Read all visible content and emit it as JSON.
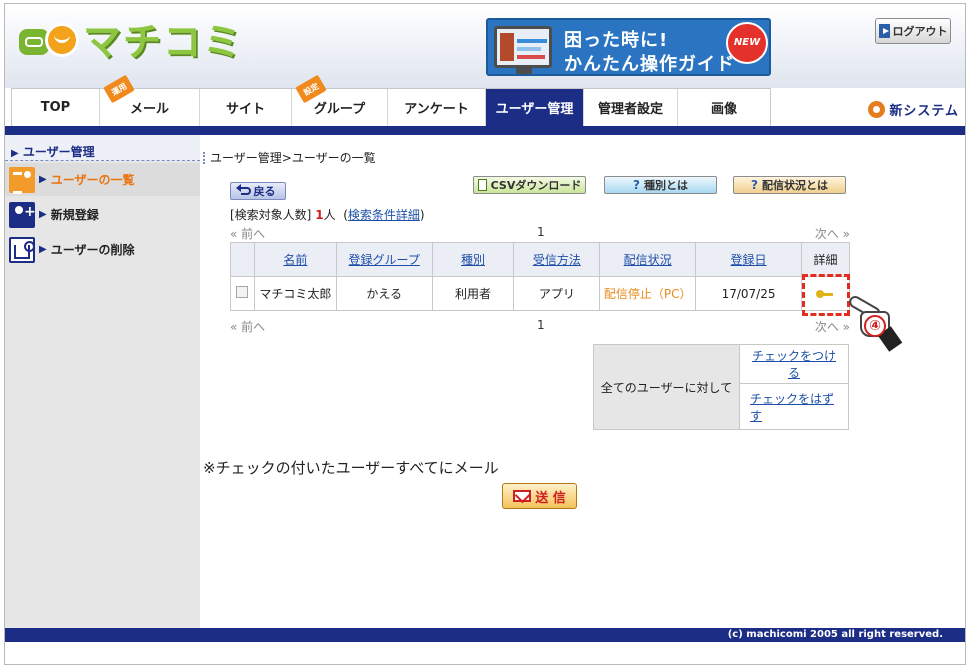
{
  "header": {
    "logo_text": "マチコミ",
    "banner": {
      "line1": "困った時に!",
      "line2": "かんたん操作ガイド",
      "badge": "NEW"
    },
    "logout_label": "ログアウト"
  },
  "nav": {
    "tabs": [
      {
        "label": "TOP",
        "ribbon": ""
      },
      {
        "label": "メール",
        "ribbon": "運用"
      },
      {
        "label": "サイト",
        "ribbon": ""
      },
      {
        "label": "グループ",
        "ribbon": "設定"
      },
      {
        "label": "アンケート",
        "ribbon": ""
      },
      {
        "label": "ユーザー管理",
        "ribbon": "",
        "active": true
      },
      {
        "label": "管理者設定",
        "ribbon": ""
      },
      {
        "label": "画像",
        "ribbon": ""
      }
    ],
    "new_system_label": "新システム"
  },
  "sidebar": {
    "title": "ユーザー管理",
    "items": [
      {
        "label": "ユーザーの一覧",
        "icon": "user-list-icon",
        "active": true
      },
      {
        "label": "新規登録",
        "icon": "user-add-icon"
      },
      {
        "label": "ユーザーの削除",
        "icon": "user-delete-icon"
      }
    ]
  },
  "main": {
    "breadcrumb": "ユーザー管理>ユーザーの一覧",
    "back_label": "戻る",
    "csv_label": "CSVダウンロード",
    "kind_label": "種別とは",
    "status_label": "配信状況とは",
    "count_prefix": "[検索対象人数]",
    "count_value": "1",
    "count_suffix": "人",
    "search_detail_link": "検索条件詳細",
    "pager": {
      "prev": "前へ",
      "page": "1",
      "next": "次へ"
    },
    "table": {
      "headers": [
        "名前",
        "登録グループ",
        "種別",
        "受信方法",
        "配信状況",
        "登録日",
        "詳細"
      ],
      "rows": [
        {
          "name": "マチコミ太郎",
          "group": "かえる",
          "kind": "利用者",
          "method": "アプリ",
          "status": "配信停止（PC）",
          "date": "17/07/25"
        }
      ]
    },
    "check_all": {
      "label": "全てのユーザーに対して",
      "check_on": "チェックをつける",
      "check_off": "チェックをはずす"
    },
    "step_badge": "④",
    "note": "※チェックの付いたユーザーすべてにメール",
    "send_label": "送 信"
  },
  "footer": {
    "copyright": "(c) machicomi 2005 all right reserved."
  },
  "colors": {
    "navy": "#1c2d86",
    "orange": "#e98a1c",
    "highlight": "#e22c1d"
  }
}
